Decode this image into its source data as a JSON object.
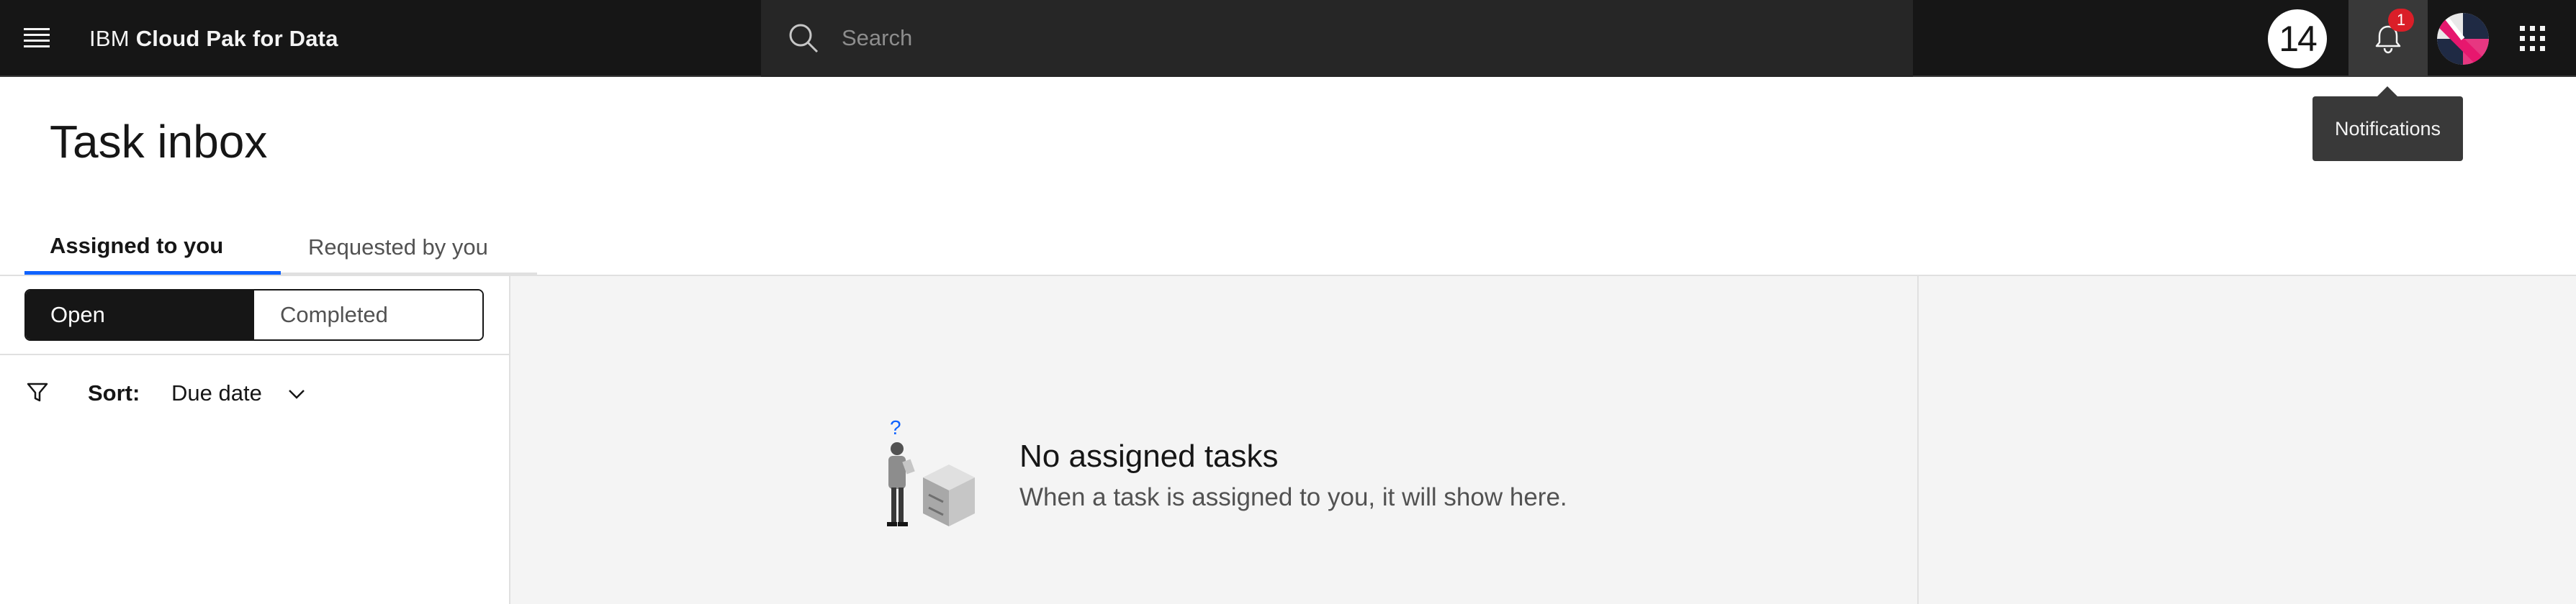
{
  "header": {
    "brand_prefix": "IBM",
    "brand_name": "Cloud Pak for Data",
    "search_placeholder": "Search",
    "counter": "14",
    "notification_count": "1",
    "tooltip": "Notifications"
  },
  "page": {
    "title": "Task inbox",
    "tabs": [
      {
        "label": "Assigned to you",
        "selected": true
      },
      {
        "label": "Requested by you",
        "selected": false
      }
    ]
  },
  "filters": {
    "switch": [
      {
        "label": "Open",
        "selected": true
      },
      {
        "label": "Completed",
        "selected": false
      }
    ],
    "sort_label": "Sort:",
    "sort_value": "Due date"
  },
  "empty_state": {
    "title": "No assigned tasks",
    "description": "When a task is assigned to you, it will show here."
  },
  "colors": {
    "header_bg": "#161616",
    "accent": "#0f62fe",
    "badge": "#da1e28",
    "panel_bg": "#f4f4f4"
  },
  "icons": [
    "menu-icon",
    "search-icon",
    "bell-icon",
    "avatar-icon",
    "app-switcher-icon",
    "filter-icon",
    "chevron-down-icon"
  ]
}
